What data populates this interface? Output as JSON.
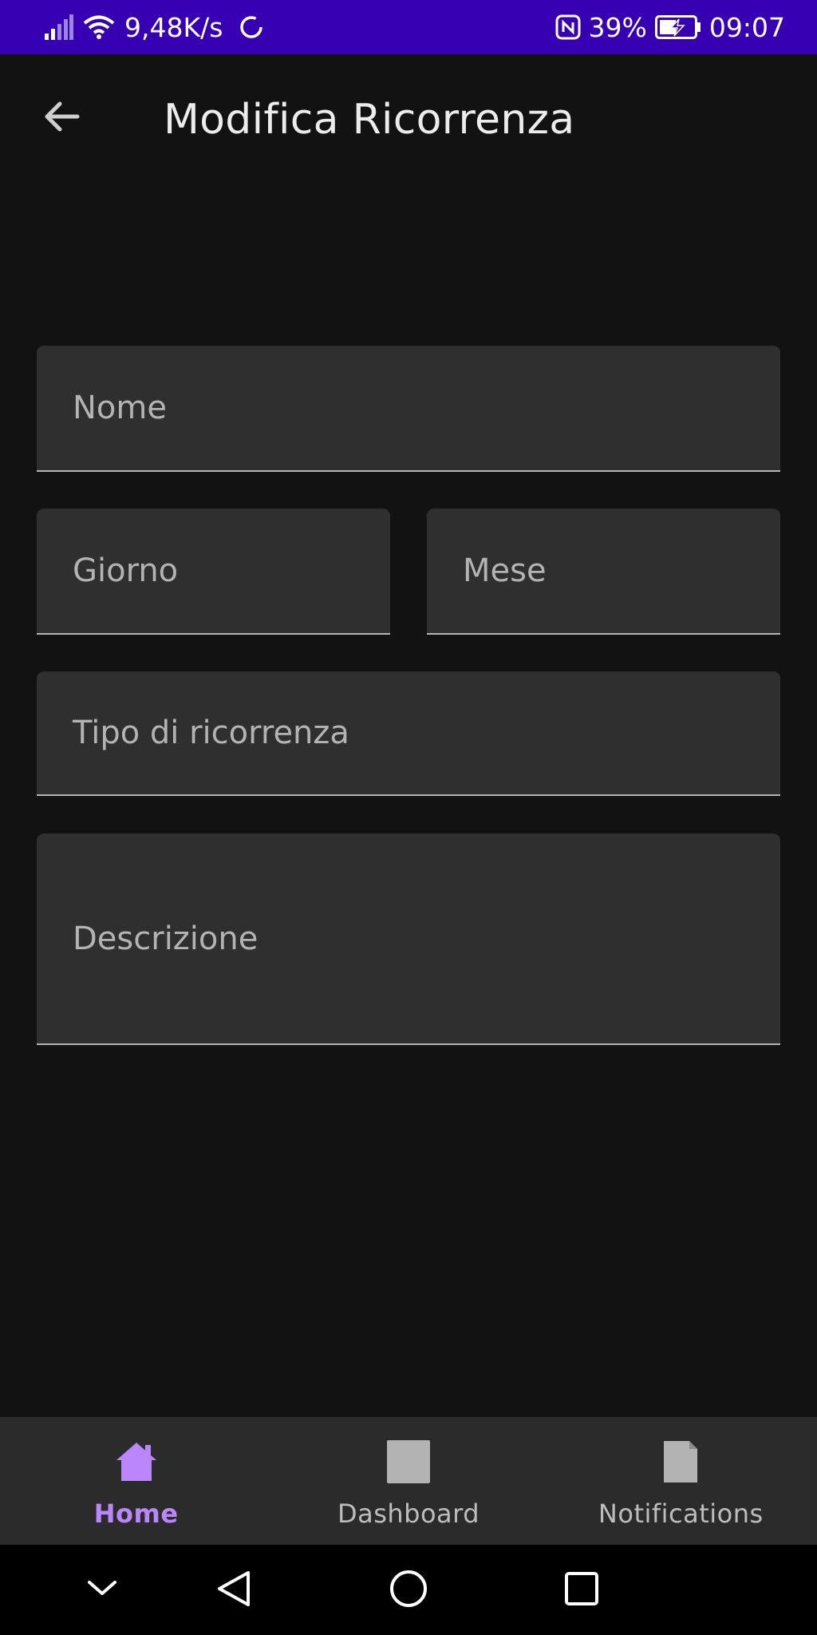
{
  "status_bar": {
    "network_speed": "9,48K/s",
    "battery_percent": "39%",
    "time": "09:07",
    "icons": [
      "signal-icon",
      "wifi-icon",
      "sync-icon",
      "nfc-icon",
      "battery-charging-icon"
    ]
  },
  "app_bar": {
    "title": "Modifica Ricorrenza",
    "back_icon": "arrow-back-icon"
  },
  "form": {
    "nome": {
      "placeholder": "Nome",
      "value": ""
    },
    "giorno": {
      "placeholder": "Giorno",
      "value": ""
    },
    "mese": {
      "placeholder": "Mese",
      "value": ""
    },
    "tipo": {
      "placeholder": "Tipo di ricorrenza",
      "value": ""
    },
    "descrizione": {
      "placeholder": "Descrizione",
      "value": ""
    }
  },
  "bottom_nav": {
    "items": [
      {
        "label": "Home",
        "icon": "home-icon",
        "active": true
      },
      {
        "label": "Dashboard",
        "icon": "dashboard-icon",
        "active": false
      },
      {
        "label": "Notifications",
        "icon": "notifications-icon",
        "active": false
      }
    ]
  },
  "system_nav": {
    "icons": [
      "collapse-icon",
      "back-triangle-icon",
      "home-circle-icon",
      "recents-square-icon"
    ]
  },
  "colors": {
    "status_bar": "#3700b3",
    "background": "#121212",
    "field_bg": "#2f2f2f",
    "accent": "#bb86fc",
    "nav_bg": "#2b2b2b"
  }
}
